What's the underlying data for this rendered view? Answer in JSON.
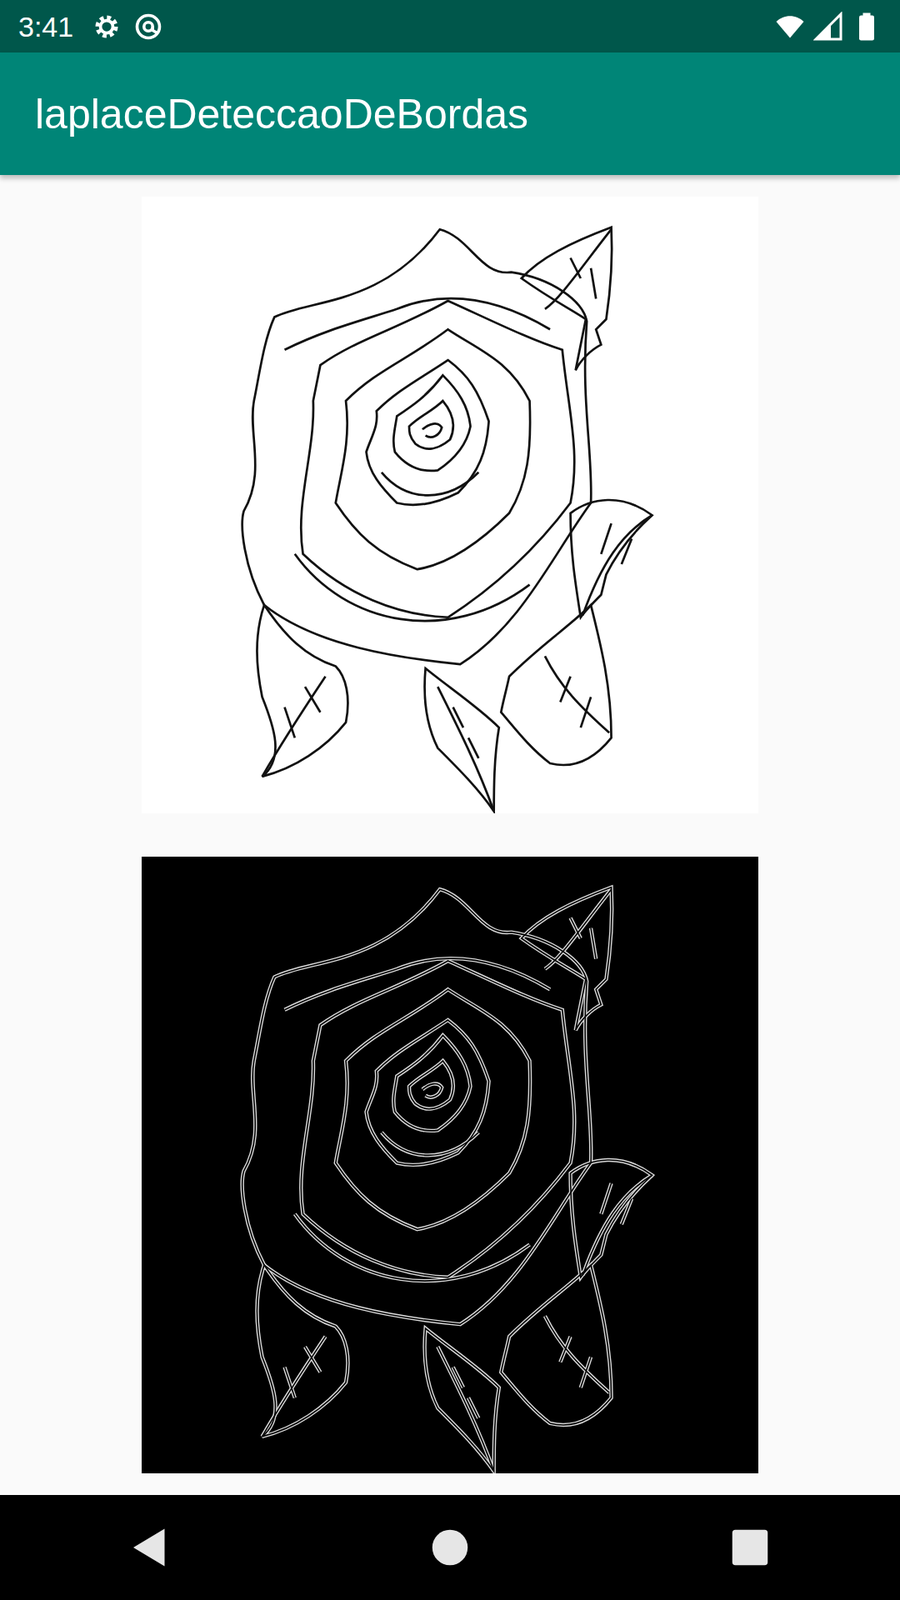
{
  "status_bar": {
    "time": "3:41"
  },
  "app_bar": {
    "title": "laplaceDeteccaoDeBordas"
  }
}
